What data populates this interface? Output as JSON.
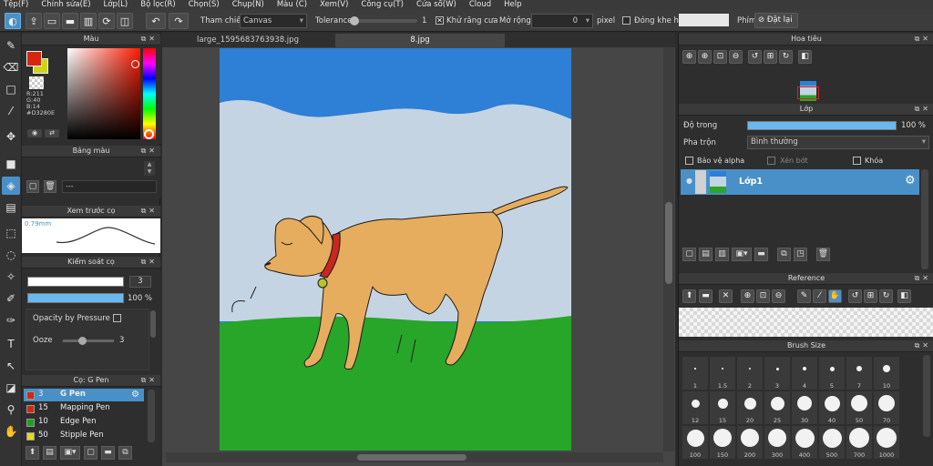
{
  "menu": [
    "Tệp(F)",
    "Chỉnh sửa(E)",
    "Lớp(L)",
    "Bộ lọc(R)",
    "Chọn(S)",
    "Chụp(N)",
    "Màu (C)",
    "Xem(V)",
    "Công cụ(T)",
    "Cửa sổ(W)",
    "Cloud",
    "Help"
  ],
  "toolbar": {
    "reference_label": "Tham chiếu",
    "reference_value": "Canvas",
    "tolerance_label": "Tolerance",
    "tolerance_value": "1",
    "antialias_label": "Khử răng cưa",
    "expand_label": "Mở rộng",
    "expand_value": "0",
    "expand_unit": "pixel",
    "close_gap_label": "Đóng khe hở",
    "key_label": "Phím",
    "reset_label": "Đặt lại"
  },
  "left": {
    "color_title": "Màu",
    "rgb_r": "R:211",
    "rgb_g": "G:40",
    "rgb_b": "B:14",
    "hex": "#D3280E",
    "palette_title": "Bảng màu",
    "palette_value": "---",
    "preview_title": "Xem trước cọ",
    "preview_size": "0.79mm",
    "brushctl_title": "Kiểm soát cọ",
    "size_value": "3",
    "opacity_value": "100 %",
    "opacity_pressure": "Opacity by Pressure",
    "ooze_label": "Ooze",
    "ooze_value": "3",
    "brushlist_title": "Cọ: G Pen",
    "brushes": [
      {
        "size": "3",
        "name": "G Pen",
        "color": "#d3280e"
      },
      {
        "size": "15",
        "name": "Mapping Pen",
        "color": "#d3280e"
      },
      {
        "size": "10",
        "name": "Edge Pen",
        "color": "#1aa31a"
      },
      {
        "size": "50",
        "name": "Stipple Pen",
        "color": "#e8d61a"
      }
    ]
  },
  "tabs": [
    "large_1595683763938.jpg",
    "8.jpg"
  ],
  "right": {
    "navigator_title": "Hoa tiêu",
    "layer_title": "Lớp",
    "opacity_label": "Độ trong",
    "opacity_value": "100 %",
    "blend_label": "Pha trộn",
    "blend_value": "Bình thường",
    "protect_alpha": "Bảo vệ alpha",
    "clipping": "Xén bớt",
    "lock": "Khóa",
    "layer_name": "Lớp1",
    "reference_title": "Reference",
    "brushsize_title": "Brush Size",
    "sizes": [
      "1",
      "1.5",
      "2",
      "3",
      "4",
      "5",
      "7",
      "10",
      "12",
      "15",
      "20",
      "25",
      "30",
      "40",
      "50",
      "70",
      "100",
      "150",
      "200",
      "300",
      "400",
      "500",
      "700",
      "1000"
    ]
  },
  "colors": {
    "fg": "#d3280e",
    "bg": "#cbd31e",
    "accent": "#4a90c8",
    "sky": "#2e7fd6",
    "cloud": "#c5d4e3",
    "grass": "#27a62a",
    "dog": "#e6ad5e",
    "collar": "#c8281e"
  }
}
